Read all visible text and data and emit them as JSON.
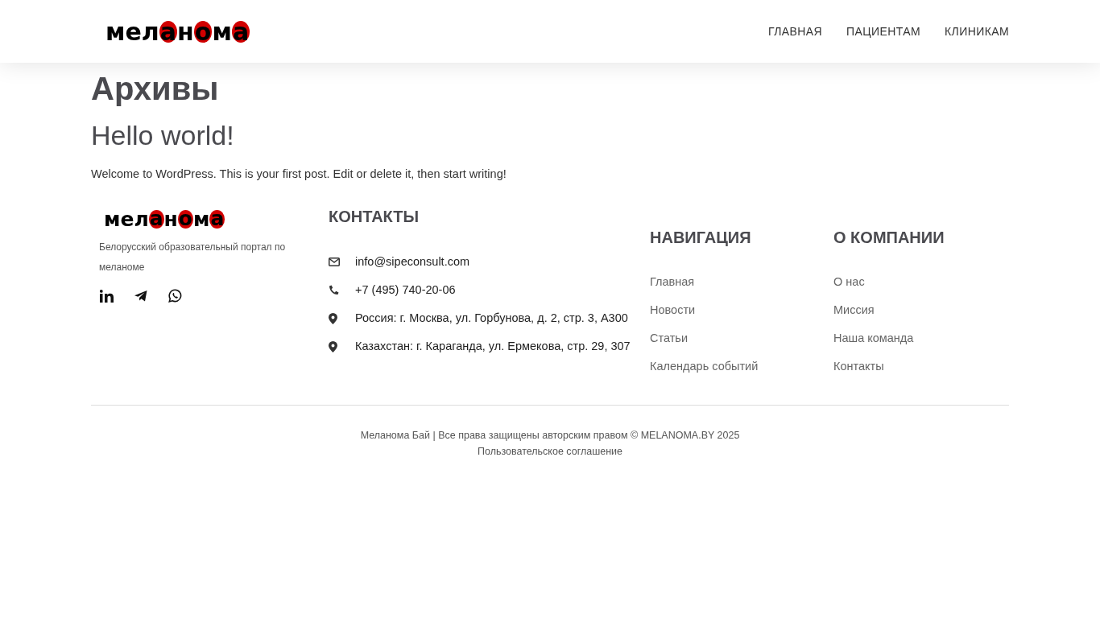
{
  "header": {
    "logo": [
      {
        "text": "мел",
        "accent": false
      },
      {
        "text": "а",
        "accent": true
      },
      {
        "text": "н",
        "accent": false
      },
      {
        "text": "о",
        "accent": true
      },
      {
        "text": "м",
        "accent": false
      },
      {
        "text": "а",
        "accent": true
      }
    ],
    "nav": [
      "ГЛАВНАЯ",
      "ПАЦИЕНТАМ",
      "КЛИНИКАМ"
    ]
  },
  "page_title": "Архивы",
  "post": {
    "title": "Hello world!",
    "excerpt": "Welcome to WordPress. This is your first post. Edit or delete it, then start writing!"
  },
  "footer": {
    "about": {
      "logo": [
        {
          "text": "мел",
          "accent": false
        },
        {
          "text": "а",
          "accent": true
        },
        {
          "text": "н",
          "accent": false
        },
        {
          "text": "о",
          "accent": true
        },
        {
          "text": "м",
          "accent": false
        },
        {
          "text": "а",
          "accent": true
        }
      ],
      "tagline": "Белорусский образовательный портал по меланоме",
      "social": [
        {
          "kind": "linkedin"
        },
        {
          "kind": "telegram"
        },
        {
          "kind": "whatsapp"
        }
      ]
    },
    "contacts": {
      "heading": "КОНТАКТЫ",
      "items": [
        {
          "kind": "email",
          "text": "info@sipeconsult.com"
        },
        {
          "kind": "phone",
          "text": "+7 (495) 740-20-06"
        },
        {
          "kind": "location",
          "text": "Россия: г. Москва, ул. Горбунова, д. 2, стр. 3, А300"
        },
        {
          "kind": "location",
          "text": "Казахстан: г. Караганда, ул. Ермекова, стр. 29, 307"
        }
      ]
    },
    "navigation": {
      "heading": "НАВИГАЦИЯ",
      "links": [
        "Главная",
        "Новости",
        "Статьи",
        "Календарь событий"
      ]
    },
    "company": {
      "heading": "О КОМПАНИИ",
      "links": [
        "О нас",
        "Миссия",
        "Наша команда",
        "Контакты"
      ]
    },
    "copyright": "Меланома Бай | Все права защищены авторским правом © MELANOMA.BY 2025",
    "agreement": "Пользовательское соглашение"
  }
}
